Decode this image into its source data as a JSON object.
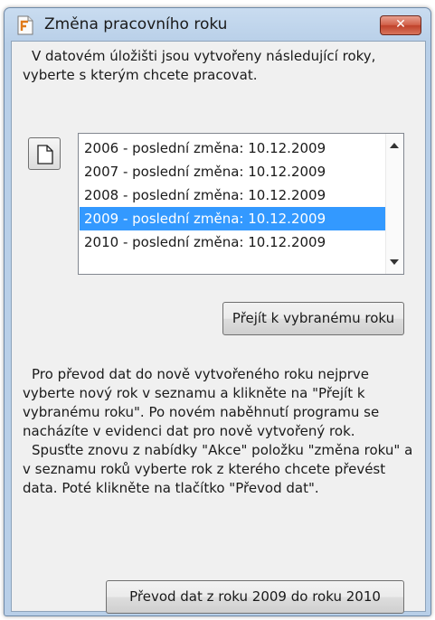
{
  "window": {
    "title": "Změna pracovního roku",
    "close_glyph": "✕",
    "app_icon": "document-f-icon"
  },
  "intro_text": "V datovém úložišti jsou vytvořeny následující roky, vyberte s kterým chcete pracovat.",
  "new_button": {
    "icon": "new-document-icon"
  },
  "years_list": {
    "items": [
      {
        "label": "2006 - poslední změna: 10.12.2009",
        "selected": false
      },
      {
        "label": "2007 - poslední změna: 10.12.2009",
        "selected": false
      },
      {
        "label": "2008 - poslední změna: 10.12.2009",
        "selected": false
      },
      {
        "label": "2009 - poslední změna: 10.12.2009",
        "selected": true
      },
      {
        "label": "2010 - poslední změna: 10.12.2009",
        "selected": false
      }
    ]
  },
  "goto_button_label": "Přejít k vybranému roku",
  "info": {
    "paragraph1": "Pro převod dat do nově vytvořeného roku nejprve vyberte nový rok v seznamu a klikněte na \"Přejít k vybranému roku\". Po novém naběhnutí programu se nacházíte v evidenci dat pro nově vytvořený  rok.",
    "paragraph2": "Spusťte znovu z nabídky \"Akce\" položku \"změna roku\" a v seznamu roků vyberte rok z kterého chcete převést data. Poté klikněte na tlačítko \"Převod dat\"."
  },
  "convert_button_label": "Převod dat z roku 2009 do roku 2010",
  "colors": {
    "selection": "#3399ff",
    "close_button": "#c94c36",
    "frame": "#b8cfe8"
  }
}
